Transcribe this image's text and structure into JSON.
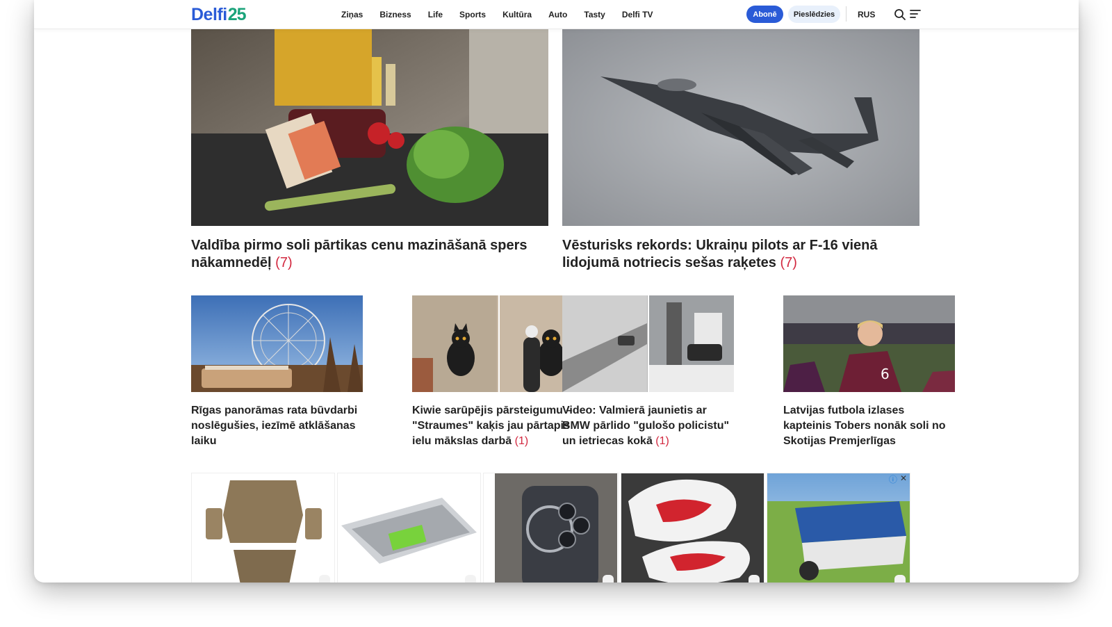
{
  "header": {
    "logo_text": "Delfi",
    "logo_number": "25",
    "nav": [
      "Ziņas",
      "Bizness",
      "Life",
      "Sports",
      "Kultūra",
      "Auto",
      "Tasty",
      "Delfi TV"
    ],
    "subscribe_label": "Abonē",
    "login_label": "Pieslēdzies",
    "language_label": "RUS",
    "brand_color": "#2a5bd7",
    "accent_color": "#1aa37a"
  },
  "featured": [
    {
      "title": "Valdība pirmo soli pārtikas cenu mazināšanā spers nākamnedēļ",
      "comments": "(7)"
    },
    {
      "title": "Vēsturisks rekords: Ukraiņu pilots ar F-16 vienā lidojumā notriecis sešas raķetes",
      "comments": "(7)"
    }
  ],
  "articles": [
    {
      "title": "Rīgas panorāmas rata būvdarbi noslēgušies, iezīmē atklāšanas laiku",
      "comments": ""
    },
    {
      "title": "Kiwie sarūpējis pārsteigumu – \"Straumes\" kaķis jau pārtapis ielu mākslas darbā",
      "comments": "(1)"
    },
    {
      "title": "Video: Valmierā jaunietis ar BMW pārlido \"gulošo policistu\" un ietriecas kokā",
      "comments": "(1)"
    },
    {
      "title": "Latvijas futbola izlases kapteinis Tobers nonāk soli no Skotijas Premjerlīgas",
      "comments": ""
    }
  ],
  "ads": {
    "comment_color": "#d2283f",
    "icons": [
      "info-icon",
      "close-icon"
    ]
  }
}
